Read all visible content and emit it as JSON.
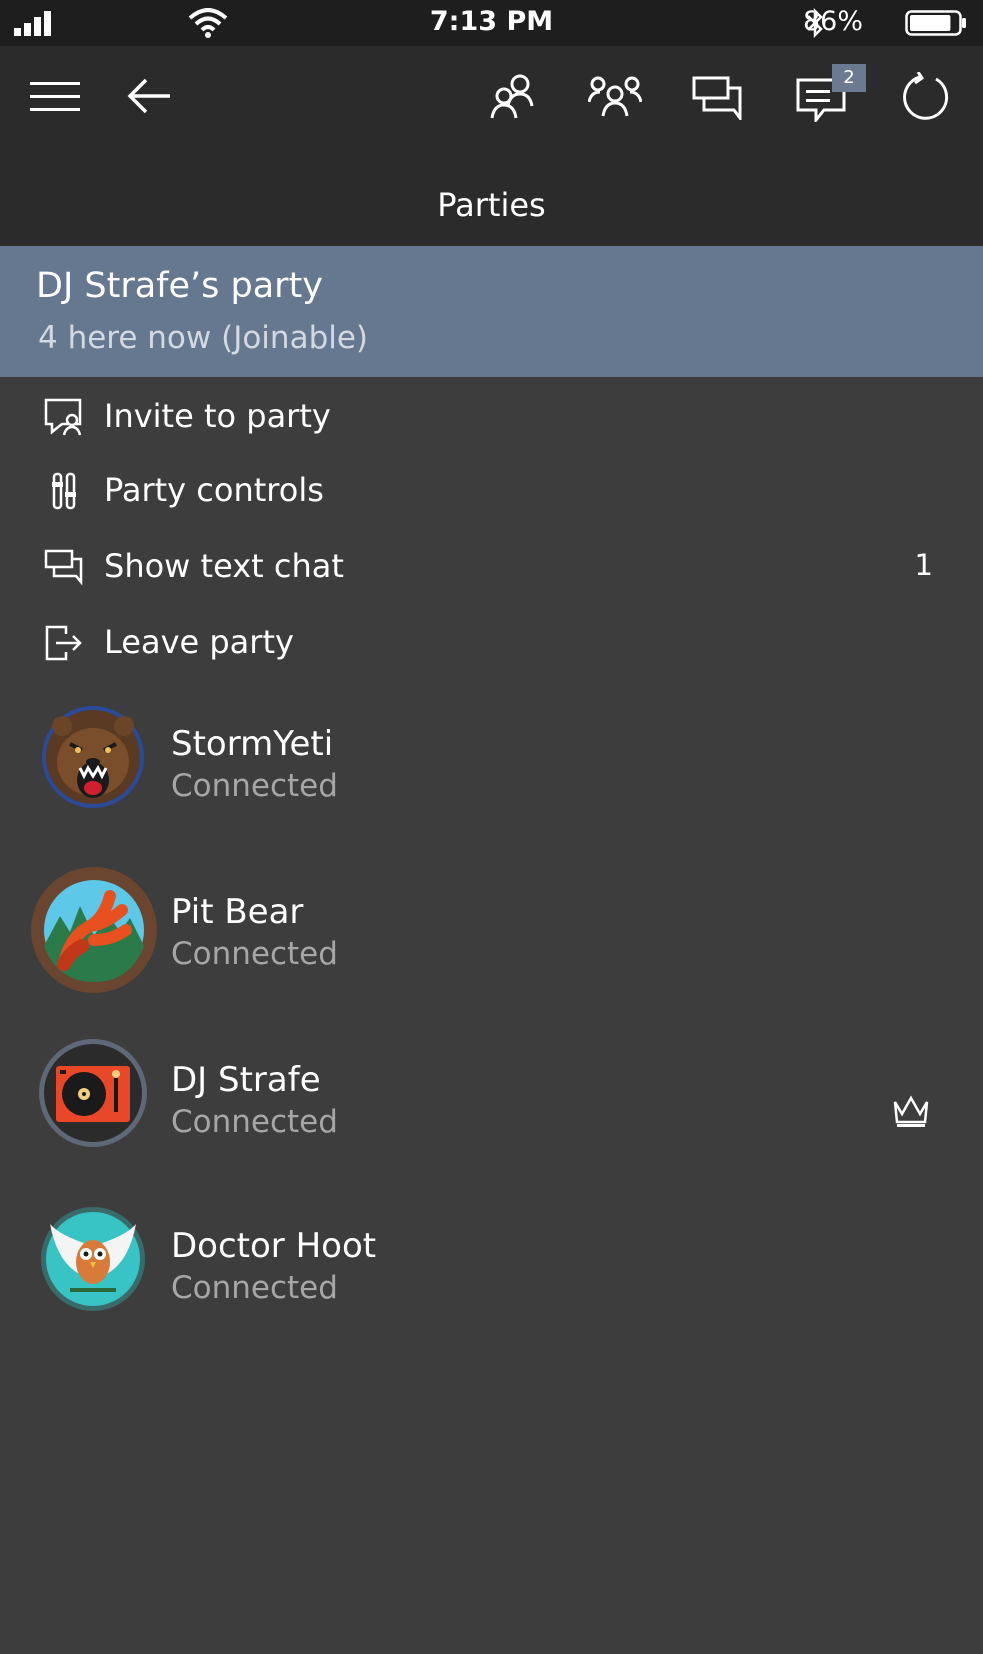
{
  "status_bar": {
    "time": "7:13 PM",
    "battery_percent": "86%",
    "battery_level": 0.86,
    "icons": [
      "signal-icon",
      "wifi-icon",
      "bluetooth-icon",
      "battery-icon"
    ]
  },
  "app_bar": {
    "title": "Parties",
    "icons": [
      "menu-icon",
      "back-arrow-icon",
      "friend-icon",
      "party-icon",
      "chat-icon",
      "messages-icon",
      "refresh-icon"
    ],
    "messages_badge": "2"
  },
  "party": {
    "name": "DJ Strafe’s party",
    "status": "4 here now (Joinable)"
  },
  "menu": [
    {
      "label": "Invite to party",
      "icon": "invite-icon",
      "count": ""
    },
    {
      "label": "Party controls",
      "icon": "controls-icon",
      "count": ""
    },
    {
      "label": "Show text chat",
      "icon": "text-chat-icon",
      "count": "1"
    },
    {
      "label": "Leave party",
      "icon": "leave-icon",
      "count": ""
    }
  ],
  "members": [
    {
      "name": "StormYeti",
      "status": "Connected",
      "avatar": "bear-avatar",
      "host": false
    },
    {
      "name": "Pit Bear",
      "status": "Connected",
      "avatar": "claw-avatar",
      "host": false
    },
    {
      "name": "DJ Strafe",
      "status": "Connected",
      "avatar": "turntable-avatar",
      "host": true
    },
    {
      "name": "Doctor Hoot",
      "status": "Connected",
      "avatar": "owl-avatar",
      "host": false
    }
  ],
  "colors": {
    "background": "#3d3d3d",
    "app_bar": "#2b2b2b",
    "status_bar": "#1e1e1e",
    "party_header": "#667790",
    "secondary_text": "#a6a6a6"
  }
}
